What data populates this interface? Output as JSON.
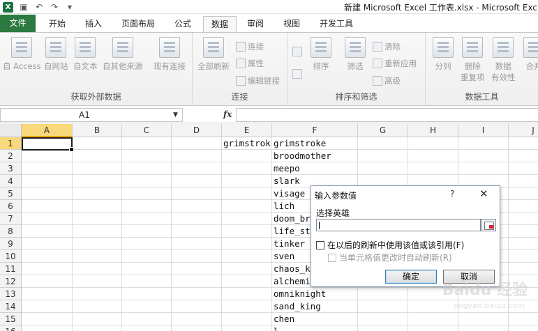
{
  "window": {
    "title": "新建 Microsoft Excel 工作表.xlsx - Microsoft Exc",
    "app_icon": "X"
  },
  "quick_access": {
    "icons": [
      "save-icon",
      "undo-icon",
      "redo-icon",
      "customize-icon"
    ]
  },
  "tabs": [
    {
      "label": "文件"
    },
    {
      "label": "开始"
    },
    {
      "label": "插入"
    },
    {
      "label": "页面布局"
    },
    {
      "label": "公式"
    },
    {
      "label": "数据"
    },
    {
      "label": "审阅"
    },
    {
      "label": "视图"
    },
    {
      "label": "开发工具"
    }
  ],
  "active_tab": "数据",
  "ribbon": {
    "external": {
      "label": "获取外部数据",
      "buttons": [
        "自 Access",
        "自网站",
        "自文本",
        "自其他来源",
        "现有连接"
      ]
    },
    "connections": {
      "label": "连接",
      "refresh_all": "全部刷新",
      "small": [
        "连接",
        "属性",
        "编辑链接"
      ]
    },
    "sort_filter": {
      "label": "排序和筛选",
      "sort": "排序",
      "filter": "筛选",
      "small": [
        "清除",
        "重新应用",
        "高级"
      ]
    },
    "data_tools": {
      "label": "数据工具",
      "buttons": [
        "分列",
        "删除",
        "重复项",
        "数据",
        "有效性",
        "合并"
      ]
    }
  },
  "formula_bar": {
    "name_box": "A1",
    "fx": "fx",
    "value": ""
  },
  "sheet": {
    "columns": [
      "A",
      "B",
      "C",
      "D",
      "E",
      "F",
      "G",
      "H",
      "I",
      "J"
    ],
    "rows": [
      "1",
      "2",
      "3",
      "4",
      "5",
      "6",
      "7",
      "8",
      "9",
      "10",
      "11",
      "12",
      "13",
      "14",
      "15",
      "16"
    ],
    "e1": "grimstrok",
    "f_values": [
      "grimstroke",
      "broodmother",
      "meepo",
      "slark",
      "visage",
      "lich",
      "doom_br",
      "life_st",
      "tinker",
      "sven",
      "chaos_k",
      "alchemi",
      "omniknight",
      "sand_king",
      "chen",
      "l"
    ]
  },
  "dialog": {
    "title": "输入参数值",
    "help": "?",
    "close": "✕",
    "prompt": "选择英雄",
    "input_value": "",
    "checkbox1": "在以后的刷新中使用该值或该引用(F)",
    "checkbox2": "当单元格值更改时自动刷新(R)",
    "ok": "确定",
    "cancel": "取消"
  },
  "watermark": {
    "text": "Baidu 经验",
    "sub": "jingyan.baidu.com"
  }
}
